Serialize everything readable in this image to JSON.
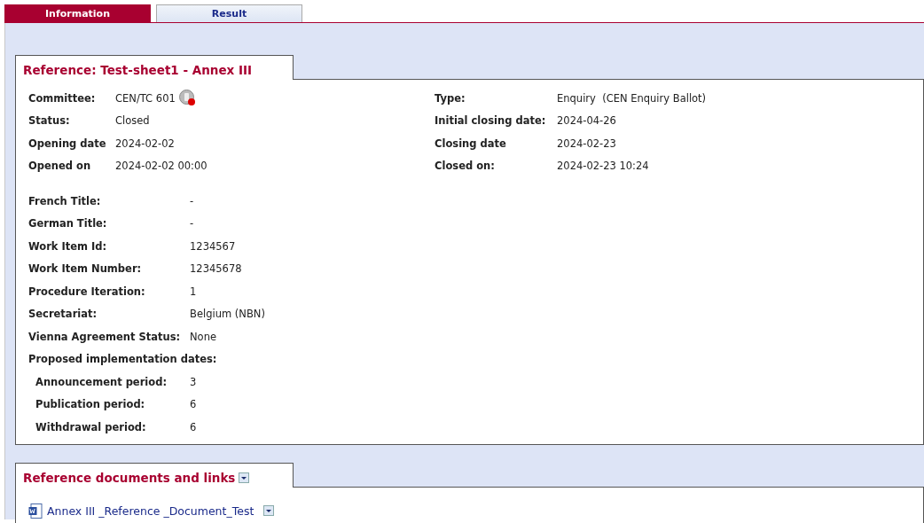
{
  "tabs": [
    {
      "label": "Information",
      "selected": true
    },
    {
      "label": "Result",
      "selected": false
    }
  ],
  "reference": {
    "title": "Reference: Test-sheet1 - Annex III",
    "left": [
      {
        "label": "Committee:",
        "value": "CEN/TC 601",
        "kind": "committee"
      },
      {
        "label": "Status:",
        "value": "Closed",
        "kind": "plain"
      },
      {
        "label": "Opening date",
        "value": "2024-02-02",
        "kind": "plain"
      },
      {
        "label": "Opened on",
        "value": "2024-02-02 00:00",
        "kind": "plain"
      }
    ],
    "right": [
      {
        "label": "Type:",
        "value": "Enquiry  (CEN Enquiry Ballot)",
        "kind": "plain"
      },
      {
        "label": "Initial closing date:",
        "value": "2024-04-26",
        "kind": "plain"
      },
      {
        "label": "Closing date",
        "value": "2024-02-23",
        "kind": "plain"
      },
      {
        "label": "Closed on:",
        "value": "2024-02-23 10:24",
        "kind": "plain"
      }
    ],
    "details": [
      {
        "label": "French Title:",
        "value": "-",
        "kind": "field"
      },
      {
        "label": "German Title:",
        "value": "-",
        "kind": "field"
      },
      {
        "label": "Work Item Id:",
        "value": "1234567",
        "kind": "field"
      },
      {
        "label": "Work Item Number:",
        "value": "12345678",
        "kind": "field"
      },
      {
        "label": "Procedure Iteration:",
        "value": "1",
        "kind": "field"
      },
      {
        "label": "Secretariat:",
        "value": "Belgium (NBN)",
        "kind": "field"
      },
      {
        "label": "Vienna Agreement Status:",
        "value": "None",
        "kind": "field"
      },
      {
        "label": "Proposed implementation dates:",
        "kind": "heading"
      },
      {
        "label": "Announcement period:",
        "value": "3",
        "kind": "sub"
      },
      {
        "label": "Publication period:",
        "value": "6",
        "kind": "sub"
      },
      {
        "label": "Withdrawal period:",
        "value": "6",
        "kind": "sub"
      }
    ]
  },
  "documents": {
    "title": "Reference documents and links",
    "items": [
      {
        "name": "Annex III _Reference _Document_Test"
      }
    ]
  }
}
